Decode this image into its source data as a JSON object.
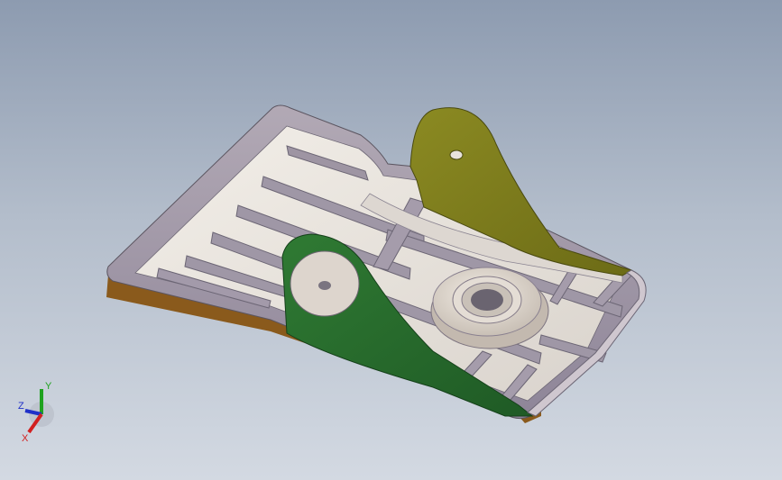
{
  "view": {
    "background_top": "#8d9bb0",
    "background_bottom": "#d3d9e2"
  },
  "part": {
    "frame_color": "#9a8f9c",
    "rib_color": "#8f8a96",
    "floor_color": "#e7e2dd",
    "lug_back_color": "#7d7b1e",
    "lug_front_color": "#2f6e2f",
    "edge_color": "#8a5a1c"
  },
  "triad": {
    "x_label": "X",
    "y_label": "Y",
    "z_label": "Z",
    "x_color": "#d22020",
    "y_color": "#1fa21f",
    "z_color": "#2030c8"
  }
}
